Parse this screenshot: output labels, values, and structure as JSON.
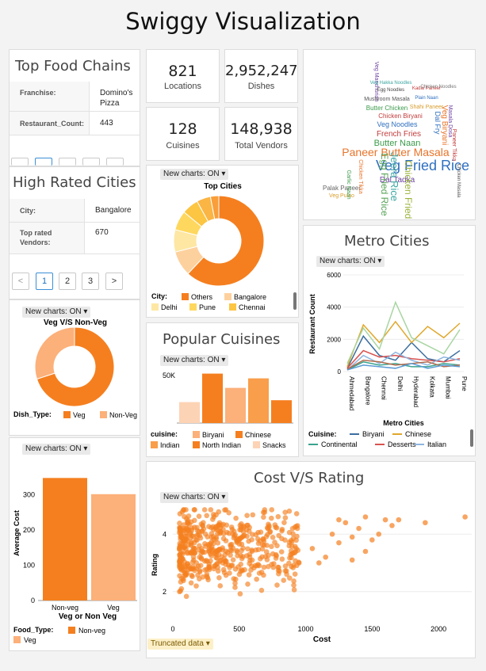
{
  "header": {
    "title": "Swiggy Visualization"
  },
  "toggle_label": "New charts: ON",
  "kpis": [
    {
      "value": "821",
      "label": "Locations"
    },
    {
      "value": "2,952,247",
      "label": "Dishes"
    },
    {
      "value": "128",
      "label": "Cuisines"
    },
    {
      "value": "148,938",
      "label": "Total Vendors"
    }
  ],
  "top_food_chains": {
    "title": "Top Food Chains",
    "rows": [
      {
        "key": "Franchise:",
        "value": "Domino's Pizza"
      },
      {
        "key": "Restaurant_Count:",
        "value": "443"
      }
    ]
  },
  "high_rated_cities": {
    "title": "High Rated Cities",
    "rows": [
      {
        "key": "City:",
        "value": "Bangalore"
      },
      {
        "key": "Top rated Vendors:",
        "value": "670"
      }
    ],
    "pagination": {
      "prev": "<",
      "pages": [
        "1",
        "2",
        "3"
      ],
      "next": ">",
      "active": "1"
    }
  },
  "word_cloud": {
    "words": [
      {
        "text": "Veg Fried Rice",
        "color": "#2f6fbf"
      },
      {
        "text": "Paneer Butter Masala",
        "color": "#e8742a"
      },
      {
        "text": "Butter Naan",
        "color": "#3a9a4a"
      },
      {
        "text": "French Fries",
        "color": "#c23b3b"
      },
      {
        "text": "Dal Tadka",
        "color": "#6b3fa0"
      },
      {
        "text": "Chicken Fried Rice",
        "color": "#9ab33a"
      },
      {
        "text": "Jeera Rice",
        "color": "#3aa6a0"
      },
      {
        "text": "Egg Fried Rice",
        "color": "#5aa55a"
      },
      {
        "text": "Veg Noodles",
        "color": "#2f6fbf"
      },
      {
        "text": "Chicken Biryani",
        "color": "#c23b3b"
      },
      {
        "text": "Veg Biryani",
        "color": "#e8742a"
      },
      {
        "text": "Dal Fry",
        "color": "#2f6fbf"
      },
      {
        "text": "Butter Chicken",
        "color": "#3a9a4a"
      },
      {
        "text": "Shahi Paneer",
        "color": "#d89c2a"
      },
      {
        "text": "Veg Manchurian",
        "color": "#6b3fa0"
      },
      {
        "text": "Mushroom Masala",
        "color": "#555555"
      },
      {
        "text": "Palak Paneer",
        "color": "#666666"
      },
      {
        "text": "Plain Naan",
        "color": "#2f6fbf"
      },
      {
        "text": "Kadai Paneer",
        "color": "#c23b3b"
      },
      {
        "text": "Egg Noodles",
        "color": "#444444"
      },
      {
        "text": "Chicken Noodles",
        "color": "#777777"
      },
      {
        "text": "Veg Pulao",
        "color": "#d89c2a"
      },
      {
        "text": "Garlic Naan",
        "color": "#3a9a4a"
      },
      {
        "text": "Chicken Tikka",
        "color": "#e8742a"
      },
      {
        "text": "Masala Dosa",
        "color": "#6b3fa0"
      },
      {
        "text": "Veg Hakka Noodles",
        "color": "#3aa6a0"
      },
      {
        "text": "Paneer Tikka",
        "color": "#c23b3b"
      },
      {
        "text": "Chicken Masala",
        "color": "#555555"
      }
    ]
  },
  "chart_data": [
    {
      "id": "top_cities",
      "type": "pie",
      "donut": true,
      "title": "Top Cities",
      "legend_title": "City:",
      "categories": [
        "Others",
        "Bangalore",
        "Delhi",
        "Pune",
        "Chennai"
      ],
      "values": [
        62,
        9,
        8,
        7,
        6,
        5,
        3
      ],
      "colors": [
        "#f57f1f",
        "#fdd19e",
        "#fde7a3",
        "#fed85e",
        "#fcc542",
        "#fbb544",
        "#f99e3a"
      ]
    },
    {
      "id": "veg_nonveg",
      "type": "pie",
      "donut": true,
      "title": "Veg V/S Non-Veg",
      "legend_title": "Dish_Type:",
      "categories": [
        "Veg",
        "Non-Veg"
      ],
      "values": [
        70,
        30
      ],
      "colors": [
        "#f57f1f",
        "#fcb07a"
      ]
    },
    {
      "id": "popular_cuisines",
      "type": "bar",
      "title": "Popular Cuisines",
      "legend_title": "cuisine:",
      "categories": [
        "Biryani",
        "Chinese",
        "Indian",
        "North Indian",
        "Snacks"
      ],
      "order": [
        "Snacks",
        "North Indian",
        "Biryani",
        "Indian",
        "Chinese"
      ],
      "values": {
        "Snacks": 22000,
        "North Indian": 52000,
        "Biryani": 37000,
        "Indian": 47000,
        "Chinese": 24000
      },
      "colors": {
        "Biryani": "#fcb07a",
        "Chinese": "#f57f1f",
        "Indian": "#f99e4a",
        "North Indian": "#f57f1f",
        "Snacks": "#fdd3b5"
      },
      "ylim": [
        0,
        50000
      ],
      "yticks": [
        "50K"
      ]
    },
    {
      "id": "metro_cities",
      "type": "line",
      "title": "Metro Cities",
      "xlabel": "Metro Cities",
      "ylabel": "Restaurant Count",
      "x": [
        "Ahmedabad",
        "Bangalore",
        "Chennai",
        "Delhi",
        "Hyderabad",
        "Kolkata",
        "Mumbai",
        "Pune"
      ],
      "ylim": [
        0,
        6000
      ],
      "yticks": [
        0,
        2000,
        4000,
        6000
      ],
      "legend_title": "Cuisine:",
      "series": [
        {
          "name": "Biryani",
          "color": "#3c6e9e",
          "values": [
            200,
            2200,
            1000,
            700,
            1800,
            800,
            600,
            1300
          ]
        },
        {
          "name": "Chinese",
          "color": "#e0a72a",
          "values": [
            300,
            2900,
            1800,
            3100,
            1800,
            2800,
            2100,
            3000
          ]
        },
        {
          "name": "Continental",
          "color": "#3aa38e",
          "values": [
            100,
            600,
            400,
            500,
            300,
            300,
            500,
            400
          ]
        },
        {
          "name": "Desserts",
          "color": "#d9534f",
          "values": [
            200,
            1300,
            900,
            1000,
            800,
            700,
            600,
            800
          ]
        },
        {
          "name": "Italian",
          "color": "#8fb6e0",
          "values": [
            100,
            1000,
            500,
            1200,
            700,
            400,
            900,
            700
          ]
        },
        {
          "name": "",
          "color": "#a8d5a2",
          "values": [
            500,
            2700,
            1400,
            4300,
            2100,
            1600,
            1100,
            2600
          ]
        },
        {
          "name": "",
          "color": "#b36b4d",
          "values": [
            150,
            700,
            600,
            400,
            500,
            600,
            300,
            400
          ]
        },
        {
          "name": "",
          "color": "#5b9bd5",
          "values": [
            100,
            400,
            300,
            200,
            500,
            200,
            400,
            300
          ]
        }
      ]
    },
    {
      "id": "avg_cost",
      "type": "bar",
      "legend_title": "Food_Type:",
      "categories": [
        "Non-veg",
        "Veg"
      ],
      "values": [
        348,
        302
      ],
      "colors": [
        "#f57f1f",
        "#fcb07a"
      ],
      "xlabel": "Veg or Non Veg",
      "ylabel": "Average Cost",
      "ylim": [
        0,
        360
      ],
      "yticks": [
        0,
        100,
        200,
        300
      ]
    },
    {
      "id": "cost_rating",
      "type": "scatter",
      "title": "Cost V/S Rating",
      "xlabel": "Cost",
      "ylabel": "Rating",
      "xlim": [
        0,
        2250
      ],
      "ylim": [
        1.0,
        5.0
      ],
      "xticks": [
        0,
        500,
        1000,
        1500,
        2000
      ],
      "yticks": [
        2,
        4
      ],
      "color": "#f57f1f",
      "note": "Truncated data",
      "outliers": [
        [
          1100,
          3.0
        ],
        [
          1200,
          4.0
        ],
        [
          1250,
          3.7
        ],
        [
          1300,
          4.4
        ],
        [
          1350,
          3.9
        ],
        [
          1400,
          4.2
        ],
        [
          1450,
          3.4
        ],
        [
          1500,
          3.8
        ],
        [
          1550,
          4.0
        ],
        [
          1600,
          4.5
        ],
        [
          1650,
          4.3
        ],
        [
          1700,
          4.5
        ],
        [
          1900,
          4.4
        ],
        [
          2200,
          4.6
        ],
        [
          1050,
          3.5
        ],
        [
          1150,
          3.2
        ],
        [
          1250,
          4.5
        ],
        [
          1350,
          3.1
        ],
        [
          1450,
          4.6
        ],
        [
          950,
          3.0
        ]
      ]
    }
  ]
}
